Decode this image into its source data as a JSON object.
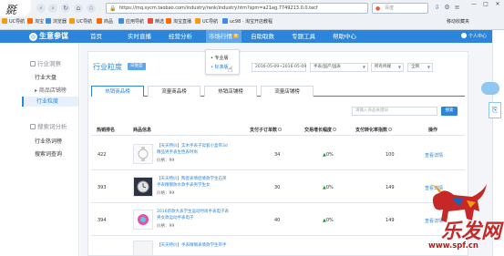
{
  "browser": {
    "url": "https://mq.sycm.taobao.com/industry/rank/industry.htm?spm=a21ag.7749213.0.0.tecf",
    "search_placeholder": "百度",
    "bookmarks": [
      "UC导航",
      "淘宝",
      "浏览器",
      "UC导航",
      "商品",
      "应用导航",
      "精选",
      "淘宝直播",
      "UC导航",
      "uc98 · 淘宝开店教程"
    ],
    "bookmarks_right": "移动收藏夹"
  },
  "site": {
    "brand": "生意参谋",
    "nav": [
      "首页",
      "实时直播",
      "经营分析",
      "市场行情",
      "自助取数",
      "专题工具",
      "帮助中心"
    ],
    "active_nav_badge": "新",
    "user": "个人中心"
  },
  "sidebar": {
    "groups": [
      {
        "title": "行业洞察",
        "items": [
          "行业大盘",
          "商品店铺榜",
          "行业粒度"
        ]
      },
      {
        "title": "搜索词分析",
        "items": [
          "行业热词榜",
          "搜索词查询"
        ]
      }
    ]
  },
  "page": {
    "title": "行业粒度",
    "tag": "日维度",
    "date_range": "2016-05-09~2016-05-09",
    "category_select": "手表/国产/国表",
    "terminal_select": "所有终端",
    "platform_select": "全网"
  },
  "dropdown": {
    "items": [
      "专业版",
      "标准版"
    ]
  },
  "tabs": [
    "热销商品榜",
    "流量商品榜",
    "热销店铺榜",
    "流量店铺榜"
  ],
  "search": {
    "placeholder": "请输入商品关键词",
    "button": "搜索"
  },
  "table": {
    "headers": [
      "热销排名",
      "商品信息",
      "支付子订单数",
      "交易增长幅度",
      "支付转化率指数",
      "操作"
    ],
    "rows": [
      {
        "rank": "422",
        "name1": "【天天特价】实木手表子母套小盒带3d",
        "name2": "精品男手表生性表时尚",
        "price": "价格：99",
        "orders": "34",
        "growth": "0%",
        "conv": "100",
        "action": "查看详情"
      },
      {
        "rank": "393",
        "name1": "【天天特价】陶瓷表情侣情款学生石英",
        "name2": "手表精钢防水款手表男学生女",
        "price": "价格：99",
        "orders": "30",
        "growth": "0%",
        "conv": "149",
        "action": "查看详情"
      },
      {
        "rank": "394",
        "name1": "2016新款大表学生运动时尚手表电子表",
        "name2": "男女款运动手表电子",
        "price": "价格：99",
        "orders": "40",
        "growth": "0%",
        "conv": "149",
        "action": "查看详情"
      },
      {
        "rank": "",
        "name1": "【天天特价】手表精钢表情款学生带手",
        "name2": "",
        "price": "",
        "orders": "",
        "growth": "",
        "conv": "",
        "action": ""
      }
    ]
  },
  "watermark": {
    "brand": "乐发网",
    "site": "www.spf.cn"
  },
  "colors": {
    "nav_blue": "#2b86db",
    "watermark_red": "#c62828"
  }
}
